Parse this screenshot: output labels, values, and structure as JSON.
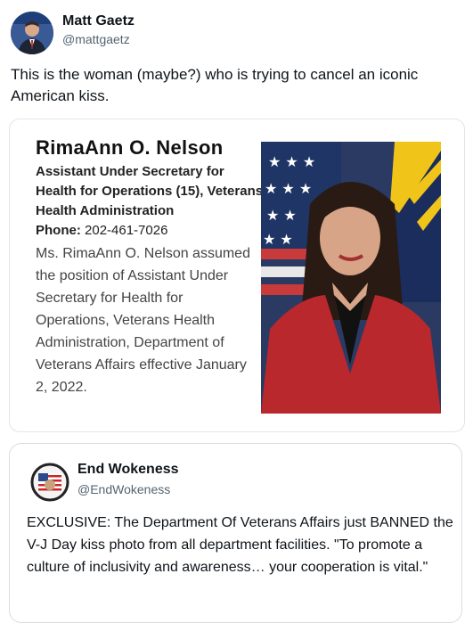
{
  "author": {
    "name": "Matt Gaetz",
    "handle": "@mattgaetz"
  },
  "tweet": {
    "text": "This is the woman (maybe?) who is trying to cancel an iconic American kiss."
  },
  "media": {
    "bio_name": "RimaAnn O. Nelson",
    "bio_title": "Assistant Under Secretary for Health for Operations (15), Veterans Health Administration",
    "phone_label": "Phone:",
    "phone_value": " 202-461-7026",
    "bio_body": "Ms. RimaAnn O. Nelson assumed the position of Assistant Under Secretary for Health for Operations, Veterans Health Administration, Department of Veterans Affairs effective January 2, 2022."
  },
  "quoted": {
    "name": "End Wokeness",
    "handle": "@EndWokeness",
    "text": "EXCLUSIVE: The Department Of Veterans Affairs just BANNED the V-J Day kiss photo from all department facilities. \"To promote a culture of inclusivity and awareness… your cooperation is vital.\""
  },
  "colors": {
    "secondary_text": "#536471",
    "border": "#e1e5ea"
  }
}
